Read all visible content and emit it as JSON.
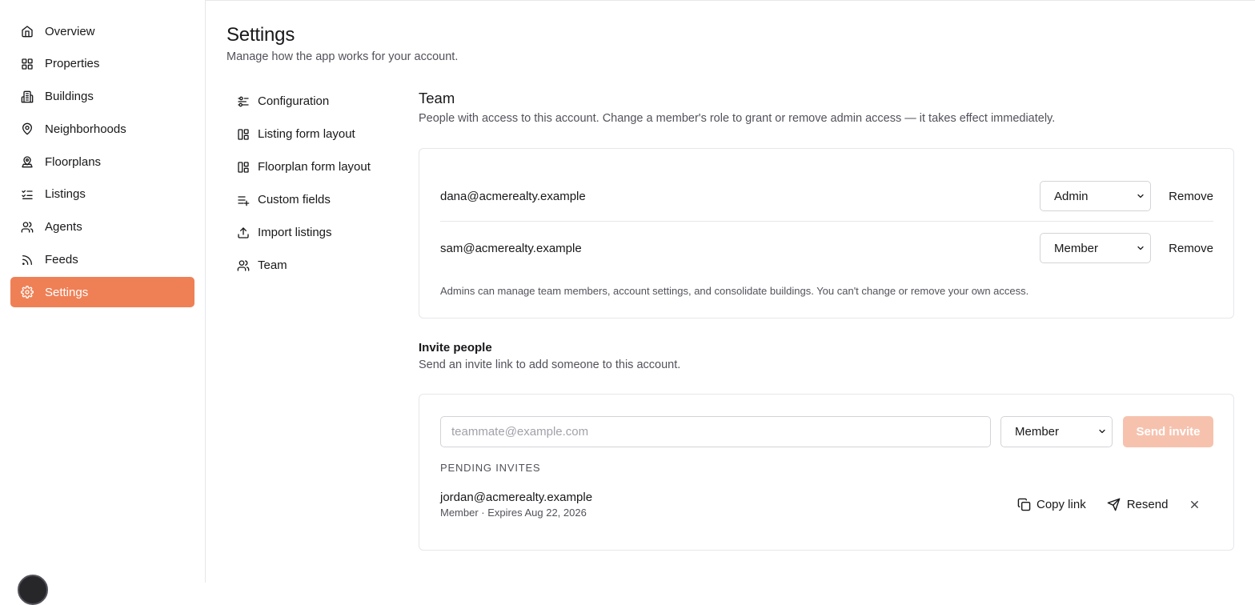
{
  "sidebar": {
    "items": [
      {
        "label": "Overview",
        "icon": "home-icon"
      },
      {
        "label": "Properties",
        "icon": "grid-icon"
      },
      {
        "label": "Buildings",
        "icon": "building-icon"
      },
      {
        "label": "Neighborhoods",
        "icon": "map-pin-icon"
      },
      {
        "label": "Floorplans",
        "icon": "map-pin-house-icon"
      },
      {
        "label": "Listings",
        "icon": "list-checks-icon"
      },
      {
        "label": "Agents",
        "icon": "users-icon"
      },
      {
        "label": "Feeds",
        "icon": "rss-icon"
      },
      {
        "label": "Settings",
        "icon": "gear-icon",
        "active": true
      }
    ],
    "active_color": "#ef8056"
  },
  "header": {
    "title": "Settings",
    "subtitle": "Manage how the app works for your account."
  },
  "settings_nav": {
    "items": [
      {
        "label": "Configuration",
        "icon": "sliders-icon"
      },
      {
        "label": "Listing form layout",
        "icon": "layout-icon"
      },
      {
        "label": "Floorplan form layout",
        "icon": "layout-icon"
      },
      {
        "label": "Custom fields",
        "icon": "list-plus-icon"
      },
      {
        "label": "Import listings",
        "icon": "upload-icon"
      },
      {
        "label": "Team",
        "icon": "users-icon"
      }
    ]
  },
  "team": {
    "title": "Team",
    "description": "People with access to this account. Change a member's role to grant or remove admin access — it takes effect immediately.",
    "members": [
      {
        "email": "dana@acmerealty.example",
        "role": "Admin",
        "remove_label": "Remove"
      },
      {
        "email": "sam@acmerealty.example",
        "role": "Member",
        "remove_label": "Remove"
      }
    ],
    "note": "Admins can manage team members, account settings, and consolidate buildings. You can't change or remove your own access."
  },
  "invite": {
    "title": "Invite people",
    "description": "Send an invite link to add someone to this account.",
    "email_placeholder": "teammate@example.com",
    "email_value": "",
    "role": "Member",
    "send_label": "Send invite",
    "pending_label": "PENDING INVITES",
    "pending": [
      {
        "email": "jordan@acmerealty.example",
        "meta": "Member · Expires Aug 22, 2026",
        "copy_label": "Copy link",
        "resend_label": "Resend"
      }
    ]
  },
  "colors": {
    "accent": "#ef8056",
    "accent_disabled": "#f6c2ae",
    "text": "#18181b",
    "muted": "#52525b",
    "border": "#e5e7eb"
  }
}
